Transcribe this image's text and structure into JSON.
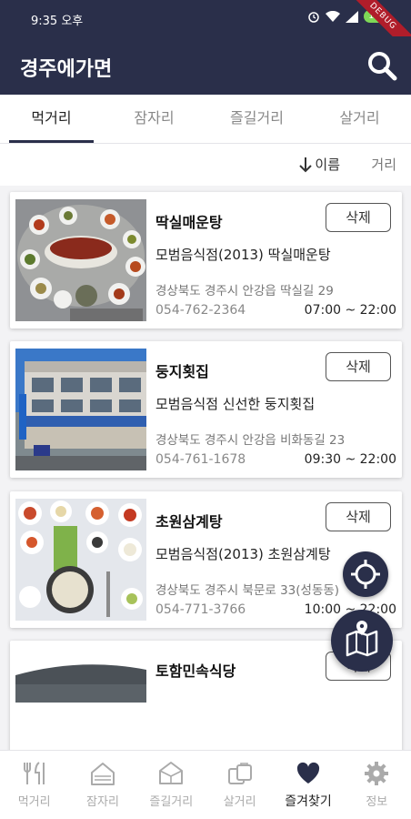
{
  "status_bar": {
    "time": "9:35 오후",
    "battery": "100",
    "debug_banner": "DEBUG"
  },
  "app_bar": {
    "title": "경주에가면",
    "search_icon": "search-icon"
  },
  "tabs": [
    {
      "label": "먹거리",
      "active": true
    },
    {
      "label": "잠자리",
      "active": false
    },
    {
      "label": "즐길거리",
      "active": false
    },
    {
      "label": "살거리",
      "active": false
    }
  ],
  "sort": {
    "name_label": "이름",
    "distance_label": "거리",
    "arrow_icon": "arrow-down-icon"
  },
  "cards": [
    {
      "name": "딱실매운탕",
      "delete_label": "삭제",
      "description": "모범음식점(2013) 딱실매운탕",
      "address": "경상북도 경주시 안강읍 딱실길 29",
      "phone": "054-762-2364",
      "hours": "07:00 ~ 22:00"
    },
    {
      "name": "둥지횟집",
      "delete_label": "삭제",
      "description": "모범음식점 신선한 둥지횟집",
      "address": "경상북도 경주시 안강읍 비화동길 23",
      "phone": "054-761-1678",
      "hours": "09:30 ~ 22:00"
    },
    {
      "name": "초원삼계탕",
      "delete_label": "삭제",
      "description": "모범음식점(2013) 초원삼계탕",
      "address": "경상북도 경주시 북문로 33(성동동)",
      "phone": "054-771-3766",
      "hours": "10:00 ~ 22:00"
    },
    {
      "name": "토함민속식당",
      "delete_label": "삭제"
    }
  ],
  "fabs": {
    "location_icon": "gps-target-icon",
    "map_icon": "map-icon"
  },
  "bottom_nav": [
    {
      "label": "먹거리",
      "icon": "fork-knife-icon",
      "active": false
    },
    {
      "label": "잠자리",
      "icon": "house-icon",
      "active": false
    },
    {
      "label": "즐길거리",
      "icon": "tent-icon",
      "active": false
    },
    {
      "label": "살거리",
      "icon": "shopping-bag-icon",
      "active": false
    },
    {
      "label": "즐겨찾기",
      "icon": "heart-icon",
      "active": true
    },
    {
      "label": "정보",
      "icon": "gear-icon",
      "active": false
    }
  ],
  "colors": {
    "primary": "#2a2f4a",
    "inactive": "#aaaaaa"
  }
}
